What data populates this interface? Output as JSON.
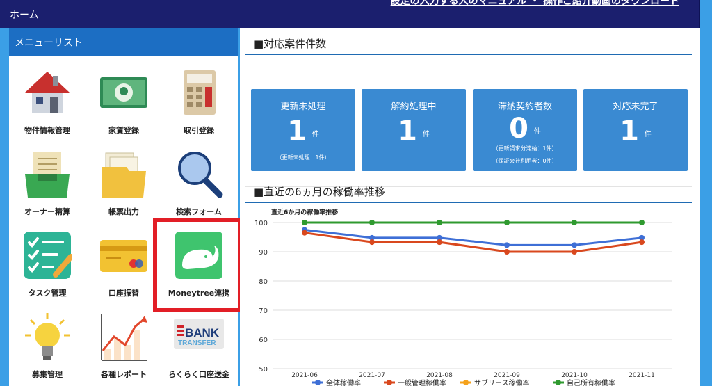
{
  "header": {
    "title": "ホーム",
    "links": "設定の入力する人のマニュアル ・ 操作ご紹介動画のダウンロード"
  },
  "sidebar": {
    "title": "メニューリスト",
    "items": [
      {
        "label": "物件情報管理",
        "icon": "house-icon"
      },
      {
        "label": "家賃登録",
        "icon": "banknote-icon"
      },
      {
        "label": "取引登録",
        "icon": "calculator-icon"
      },
      {
        "label": "オーナー精算",
        "icon": "inbox-tray-icon"
      },
      {
        "label": "帳票出力",
        "icon": "folder-icon"
      },
      {
        "label": "検索フォーム",
        "icon": "magnifier-icon"
      },
      {
        "label": "タスク管理",
        "icon": "checklist-icon"
      },
      {
        "label": "口座振替",
        "icon": "credit-card-icon"
      },
      {
        "label": "Moneytree連携",
        "icon": "moneytree-elephant-icon"
      },
      {
        "label": "募集管理",
        "icon": "lightbulb-icon"
      },
      {
        "label": "各種レポート",
        "icon": "report-chart-icon"
      },
      {
        "label": "らくらく口座送金",
        "icon": "bank-transfer-icon"
      }
    ]
  },
  "cases": {
    "title": "■対応案件件数",
    "unit": "件",
    "cards": [
      {
        "title": "更新未処理",
        "count": "1",
        "sub1": "（更新未処理：1件）",
        "sub2": ""
      },
      {
        "title": "解約処理中",
        "count": "1",
        "sub1": "",
        "sub2": ""
      },
      {
        "title": "滞納契約者数",
        "count": "0",
        "sub1": "（更新請求分滞納：1件）",
        "sub2": "（保証会社利用者：0件）"
      },
      {
        "title": "対応未完了",
        "count": "1",
        "sub1": "",
        "sub2": ""
      }
    ]
  },
  "occupancy": {
    "title": "■直近の6ヵ月の稼働率推移"
  },
  "bank_logo": {
    "line1": "BANK",
    "line2": "TRANSFER"
  },
  "chart_data": {
    "type": "line",
    "title": "直近6か月の稼働率推移",
    "categories": [
      "2021-06",
      "2021-07",
      "2021-08",
      "2021-09",
      "2021-10",
      "2021-11"
    ],
    "yticks": [
      "100",
      "90",
      "80",
      "70",
      "60",
      "50"
    ],
    "ylim": [
      50,
      100
    ],
    "series": [
      {
        "name": "全体稼働率",
        "color": "#3e6fd6",
        "values": [
          97.5,
          94.8,
          94.8,
          92.3,
          92.3,
          94.8
        ]
      },
      {
        "name": "一般管理稼働率",
        "color": "#d9481e",
        "values": [
          96.5,
          93.3,
          93.3,
          90.0,
          90.0,
          93.3
        ]
      },
      {
        "name": "サブリース稼働率",
        "color": "#f5a21b",
        "values": []
      },
      {
        "name": "自己所有稼働率",
        "color": "#2f9a2f",
        "values": [
          100,
          100,
          100,
          100,
          100,
          100
        ]
      }
    ]
  }
}
